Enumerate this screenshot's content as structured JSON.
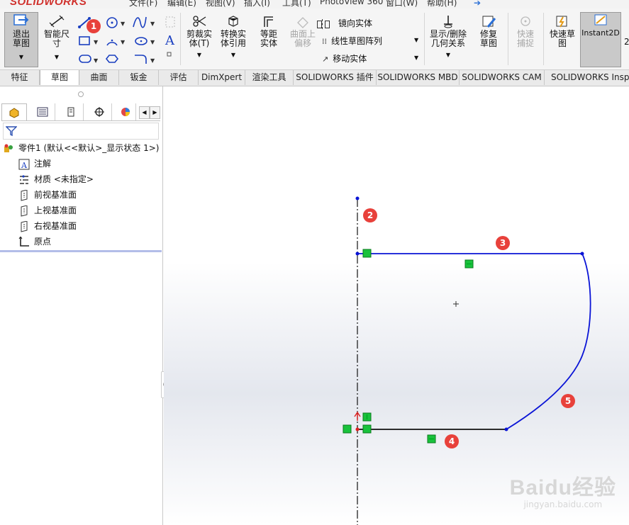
{
  "app": {
    "logo": "SOLIDWORKS",
    "menus": [
      "文件(F)",
      "编辑(E)",
      "视图(V)",
      "插入(I)",
      "工具(T)",
      "PhotoView 360",
      "窗口(W)",
      "帮助(H)"
    ]
  },
  "ribbon": {
    "exit_sketch": "退出草图",
    "smart_dim": "智能尺寸",
    "trim": "剪裁实体(T)",
    "convert": "转换实体引用",
    "offset": "等距实体",
    "surface_offset": "曲面上偏移",
    "mirror": "镜向实体",
    "linear_pattern": "线性草图阵列",
    "move": "移动实体",
    "show_delete": "显示/删除几何关系",
    "repair": "修复草图",
    "quick_snap": "快速捕捉",
    "rapid_sketch": "快速草图",
    "instant2d": "Instant2D"
  },
  "tabs": [
    "特征",
    "草图",
    "曲面",
    "钣金",
    "评估",
    "DimXpert",
    "渲染工具",
    "SOLIDWORKS 插件",
    "SOLIDWORKS MBD",
    "SOLIDWORKS CAM",
    "SOLIDWORKS Inspect"
  ],
  "active_tab": "草图",
  "tree": {
    "root": "零件1  (默认<<默认>_显示状态 1>)",
    "items": [
      "注解",
      "材质 <未指定>",
      "前视基准面",
      "上视基准面",
      "右视基准面",
      "原点"
    ]
  },
  "callouts": [
    "1",
    "2",
    "3",
    "4",
    "5"
  ],
  "watermark": {
    "brand": "Baidu经验",
    "url": "jingyan.baidu.com"
  },
  "colors": {
    "sketch_blue": "#0a14d6",
    "callout_red": "#e8413b",
    "relation_green": "#19c23c"
  }
}
